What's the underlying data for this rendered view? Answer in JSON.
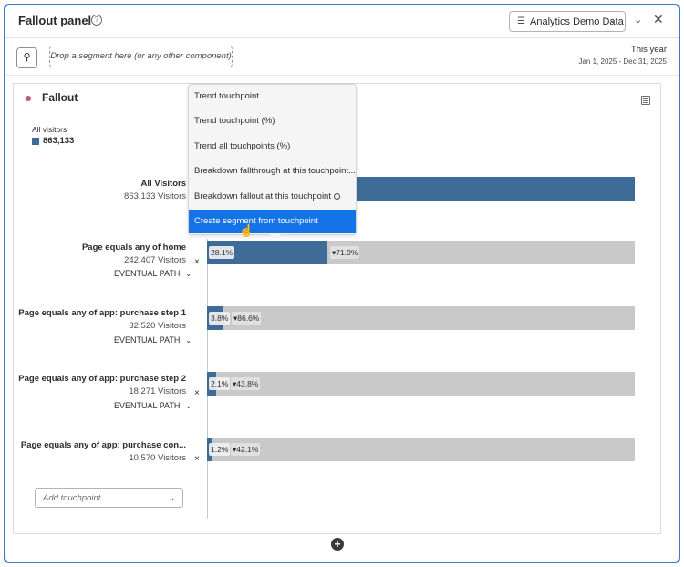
{
  "header": {
    "title": "Fallout panel",
    "help_icon": "help-icon",
    "data_source": "Analytics Demo Data",
    "collapse_icon": "chevron-down-icon",
    "close_icon": "close-icon"
  },
  "segment_bar": {
    "filter_icon": "filter-icon",
    "drop_placeholder": "Drop a segment here (or any other component)",
    "date_title": "This year",
    "date_range": "Jan 1, 2025 - Dec 31, 2025"
  },
  "viz": {
    "title": "Fallout",
    "status_color": "#c4577b",
    "legend_label": "All visitors",
    "legend_value": "863,133",
    "series_color": "#3f6b97",
    "remainder_color": "#c9c9c9",
    "touchpoints": [
      {
        "name": "All Visitors",
        "visitors": "863,133 Visitors",
        "path": "",
        "pct_through": 100,
        "label_through": "",
        "label_fallout": ""
      },
      {
        "name": "Page equals any of home",
        "visitors": "242,407 Visitors",
        "path": "EVENTUAL PATH",
        "pct_through": 28.1,
        "label_through": "28.1%",
        "label_fallout": "▾71.9%"
      },
      {
        "name": "Page equals any of app: purchase step 1",
        "visitors": "32,520 Visitors",
        "path": "EVENTUAL PATH",
        "pct_through": 3.8,
        "label_through": "3.8%",
        "label_fallout": "▾86.6%"
      },
      {
        "name": "Page equals any of app: purchase step 2",
        "visitors": "18,271 Visitors",
        "path": "EVENTUAL PATH",
        "pct_through": 2.1,
        "label_through": "2.1%",
        "label_fallout": "▾43.8%"
      },
      {
        "name": "Page equals any of app: purchase con...",
        "visitors": "10,570 Visitors",
        "path": "",
        "pct_through": 1.2,
        "label_through": "1.2%",
        "label_fallout": "▾42.1%"
      }
    ],
    "add_touchpoint_placeholder": "Add touchpoint"
  },
  "context_menu": {
    "items": [
      "Trend touchpoint",
      "Trend touchpoint (%)",
      "Trend all touchpoints (%)",
      "Breakdown fallthrough at this touchpoint...",
      "Breakdown fallout at this touchpoint",
      "Create segment from touchpoint"
    ],
    "selected_index": 5,
    "selected_color": "#1473e6"
  }
}
